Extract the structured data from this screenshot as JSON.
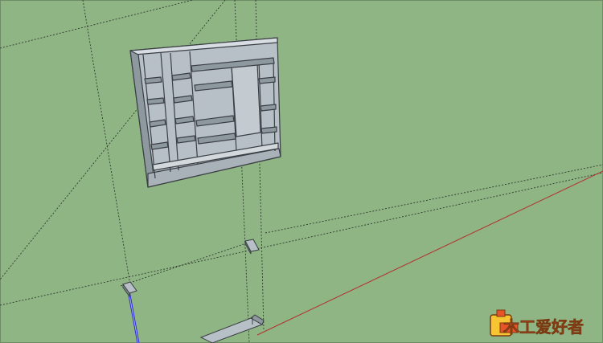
{
  "viewport": {
    "background_color": "#8fb584",
    "border_color": "#6e8d67"
  },
  "axes": {
    "red_axis_color": "#b3302f",
    "blue_axis_color": "#2a2ad6",
    "inference_line_color": "#2e3a2e"
  },
  "model": {
    "cabinet_face_color": "#b7c0c7",
    "cabinet_edge_color": "#3a3f44",
    "cabinet_shadow_color": "#8e989f"
  },
  "watermark": {
    "icon": "woodworker-logo-icon",
    "text": "木工爱好者",
    "primary_color": "#e8542a",
    "accent_color": "#f6c531"
  }
}
